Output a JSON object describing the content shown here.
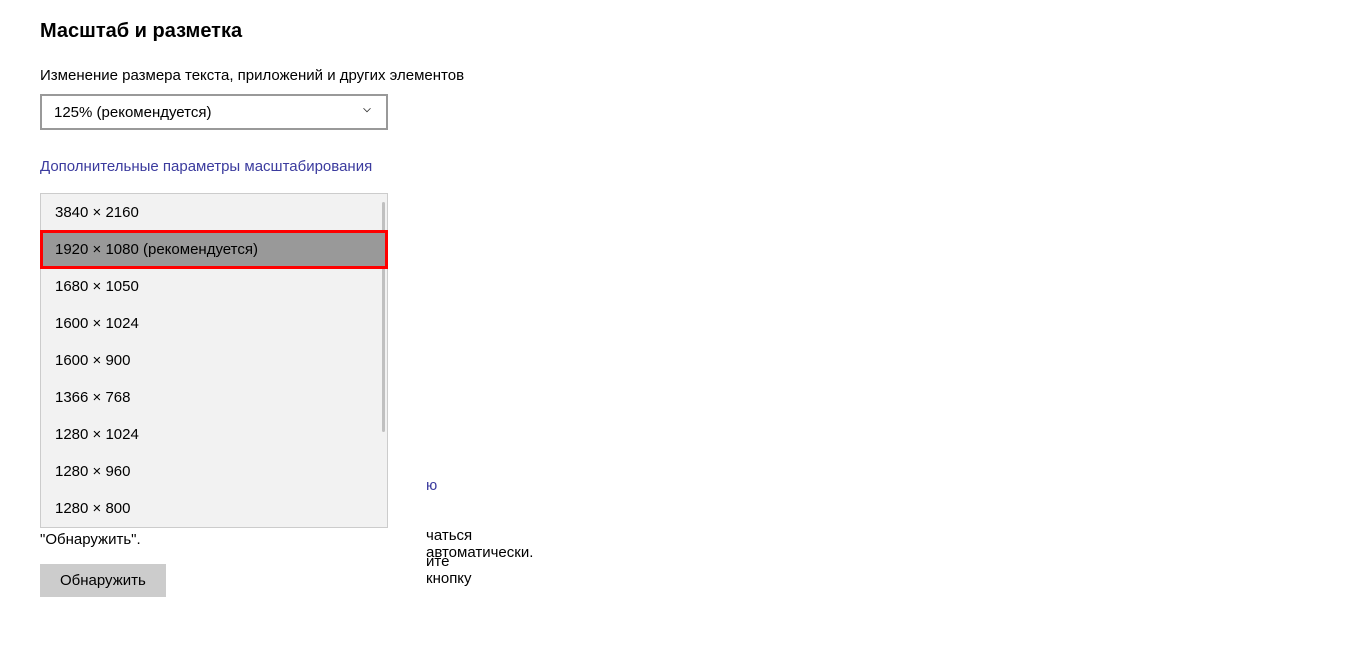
{
  "section": {
    "title": "Масштаб и разметка"
  },
  "scale": {
    "label": "Изменение размера текста, приложений и других элементов",
    "value": "125% (рекомендуется)"
  },
  "link": {
    "advanced_scaling": "Дополнительные параметры масштабирования"
  },
  "resolutions": {
    "items": [
      "3840 × 2160",
      "1920 × 1080 (рекомендуется)",
      "1680 × 1050",
      "1600 × 1024",
      "1600 × 900",
      "1366 × 768",
      "1280 × 1024",
      "1280 × 960",
      "1280 × 800"
    ]
  },
  "behind": {
    "link_fragment": "ю",
    "line1_fragment": "чаться автоматически.",
    "line2_fragment": "ите кнопку"
  },
  "below": {
    "line3": "\"Обнаружить\"."
  },
  "button": {
    "detect": "Обнаружить"
  }
}
